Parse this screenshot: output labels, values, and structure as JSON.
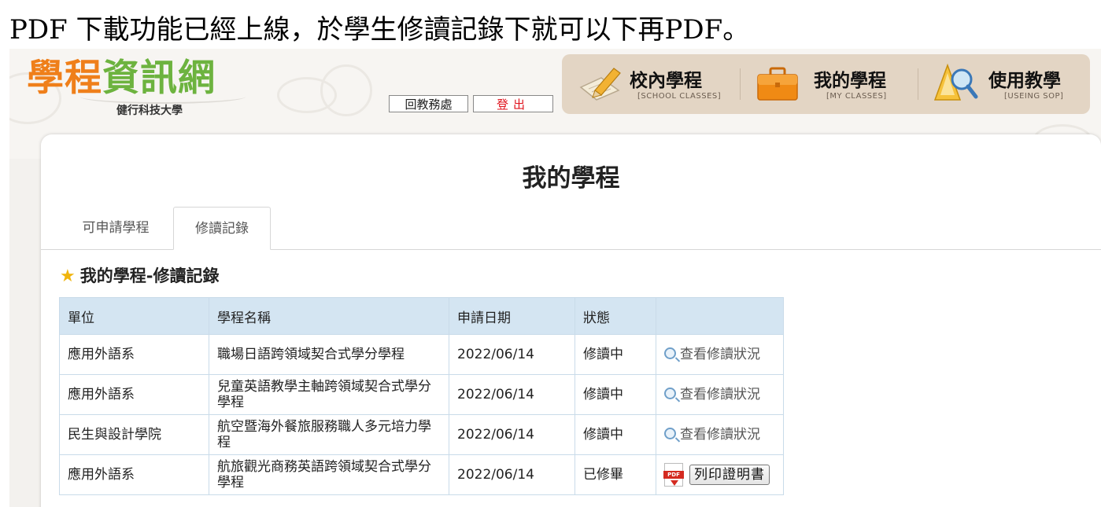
{
  "caption": "PDF 下載功能已經上線，於學生修讀記錄下就可以下再PDF。",
  "header": {
    "logo_chars": [
      "學",
      "程",
      "資",
      "訊",
      "網"
    ],
    "school_name": "健行科技大學",
    "back_button": "回教務處",
    "logout_button": "登出"
  },
  "nav": {
    "items": [
      {
        "zh": "校內學程",
        "en": "[SCHOOL CLASSES]",
        "icon": "pencil-paper-icon"
      },
      {
        "zh": "我的學程",
        "en": "[MY CLASSES]",
        "icon": "briefcase-icon"
      },
      {
        "zh": "使用教學",
        "en": "[USEING SOP]",
        "icon": "magnifier-triangle-icon"
      }
    ]
  },
  "main": {
    "title": "我的學程",
    "tabs": [
      {
        "label": "可申請學程",
        "active": false
      },
      {
        "label": "修讀記錄",
        "active": true
      }
    ],
    "section_title": "我的學程-修讀記錄"
  },
  "table": {
    "headers": [
      "單位",
      "學程名稱",
      "申請日期",
      "狀態",
      ""
    ],
    "rows": [
      {
        "unit": "應用外語系",
        "program": "職場日語跨領域契合式學分學程",
        "date": "2022/06/14",
        "status": "修讀中",
        "action": "view",
        "action_label": "查看修讀狀況"
      },
      {
        "unit": "應用外語系",
        "program": "兒童英語教學主軸跨領域契合式學分學程",
        "date": "2022/06/14",
        "status": "修讀中",
        "action": "view",
        "action_label": "查看修讀狀況"
      },
      {
        "unit": "民生與設計學院",
        "program": "航空暨海外餐旅服務職人多元培力學程",
        "date": "2022/06/14",
        "status": "修讀中",
        "action": "view",
        "action_label": "查看修讀狀況"
      },
      {
        "unit": "應用外語系",
        "program": "航旅觀光商務英語跨領域契合式學分學程",
        "date": "2022/06/14",
        "status": "已修畢",
        "action": "print",
        "action_label": "列印證明書",
        "pdf_badge": "PDF"
      }
    ]
  },
  "colors": {
    "logo_orange": "#ef7f1a",
    "logo_green": "#6db33f",
    "nav_bg": "#e3d5c4",
    "table_header": "#d4e5f2",
    "logout_red": "#e0141e"
  }
}
